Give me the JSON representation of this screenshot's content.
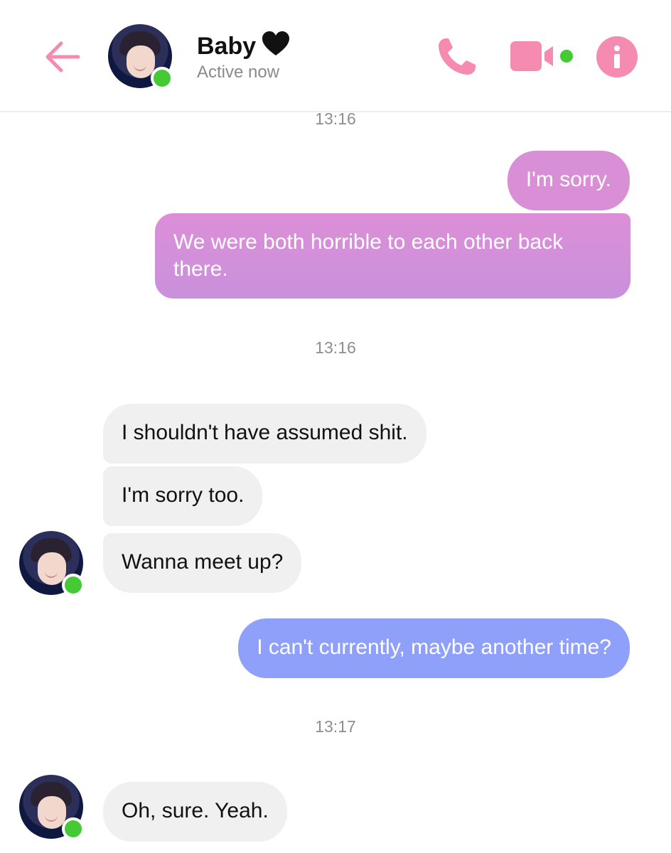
{
  "header": {
    "contact_name": "Baby",
    "status": "Active now",
    "accent_color": "#f58bb0",
    "icons": [
      "back-arrow-icon",
      "black-heart-icon",
      "phone-icon",
      "video-camera-icon",
      "info-icon"
    ]
  },
  "thread": {
    "timestamps": [
      "13:16",
      "13:16",
      "13:17"
    ],
    "messages": [
      {
        "sender": "me",
        "text": "I'm sorry.",
        "color": "#d98fd6"
      },
      {
        "sender": "me",
        "text": "We were both horrible to each other back there.",
        "color": "#d28fd8"
      },
      {
        "sender": "them",
        "text": "I shouldn't have assumed shit."
      },
      {
        "sender": "them",
        "text": "I'm sorry too."
      },
      {
        "sender": "them",
        "text": "Wanna meet up?"
      },
      {
        "sender": "me",
        "text": "I can't currently, maybe another time?",
        "color": "#8fa0fb"
      },
      {
        "sender": "them",
        "text": "Oh, sure. Yeah."
      }
    ]
  }
}
